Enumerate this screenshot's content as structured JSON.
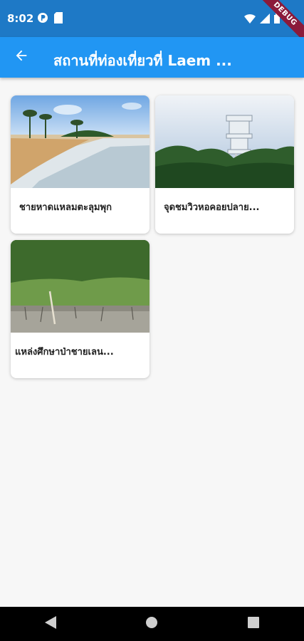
{
  "status_bar": {
    "time": "8:02",
    "icons": [
      "notification-icon",
      "sd-card-icon",
      "wifi-icon",
      "signal-icon",
      "battery-icon"
    ],
    "ribbon": "DEBUG"
  },
  "app_bar": {
    "title": "สถานที่ท่องเที่ยวที่ Laem ...",
    "back_icon": "arrow-back-icon",
    "background": "#2196f3"
  },
  "places": [
    {
      "title": "ชายหาดแหลมตะลุมพุก",
      "image": "beach-image"
    },
    {
      "title": "จุดชมวิวหอคอยปลาย...",
      "image": "watchtower-image"
    },
    {
      "title": "แหล่งศึกษาป่าชายเลน...",
      "image": "mangrove-image"
    }
  ],
  "nav_bar": {
    "icons": [
      "back-triangle-icon",
      "home-circle-icon",
      "recents-square-icon"
    ]
  }
}
